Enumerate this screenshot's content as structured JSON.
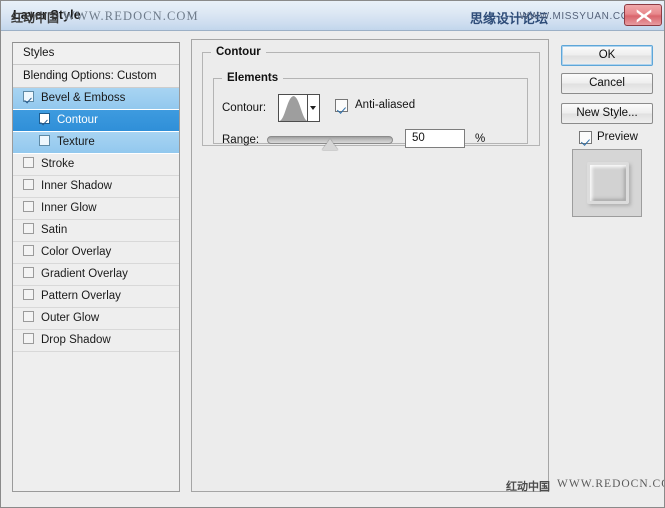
{
  "window": {
    "title": "Layer Style",
    "close_icon": "close-x-icon"
  },
  "watermarks": {
    "title_cn": "红动中国",
    "title_url": "WWW.REDOCN.COM",
    "right_cn": "思缘设计论坛",
    "right_url": "WWW.MISSYUAN.COM",
    "bottom_cn": "红动中国",
    "bottom_url": "WWW.REDOCN.COM"
  },
  "styles_panel": {
    "header": "Styles",
    "blending_options": "Blending Options: Custom",
    "items": [
      {
        "label": "Bevel & Emboss",
        "checked": true,
        "selected": false,
        "sub": false,
        "highlight": "light"
      },
      {
        "label": "Contour",
        "checked": true,
        "selected": true,
        "sub": true,
        "highlight": "strong"
      },
      {
        "label": "Texture",
        "checked": false,
        "selected": false,
        "sub": true,
        "highlight": "light"
      },
      {
        "label": "Stroke",
        "checked": false,
        "selected": false,
        "sub": false,
        "highlight": "none"
      },
      {
        "label": "Inner Shadow",
        "checked": false,
        "selected": false,
        "sub": false,
        "highlight": "none"
      },
      {
        "label": "Inner Glow",
        "checked": false,
        "selected": false,
        "sub": false,
        "highlight": "none"
      },
      {
        "label": "Satin",
        "checked": false,
        "selected": false,
        "sub": false,
        "highlight": "none"
      },
      {
        "label": "Color Overlay",
        "checked": false,
        "selected": false,
        "sub": false,
        "highlight": "none"
      },
      {
        "label": "Gradient Overlay",
        "checked": false,
        "selected": false,
        "sub": false,
        "highlight": "none"
      },
      {
        "label": "Pattern Overlay",
        "checked": false,
        "selected": false,
        "sub": false,
        "highlight": "none"
      },
      {
        "label": "Outer Glow",
        "checked": false,
        "selected": false,
        "sub": false,
        "highlight": "none"
      },
      {
        "label": "Drop Shadow",
        "checked": false,
        "selected": false,
        "sub": false,
        "highlight": "none"
      }
    ]
  },
  "contour_panel": {
    "group_title": "Contour",
    "elements_title": "Elements",
    "contour_label": "Contour:",
    "contour_preset_icon": "contour-curve-swatch",
    "contour_dropdown_icon": "chevron-down-icon",
    "anti_aliased_label": "Anti-aliased",
    "anti_aliased_checked": true,
    "range_label": "Range:",
    "range_value": "50",
    "range_unit": "%",
    "range_percent": 50
  },
  "buttons": {
    "ok": "OK",
    "cancel": "Cancel",
    "new_style": "New Style...",
    "preview_label": "Preview",
    "preview_checked": true
  },
  "colors": {
    "accent_selected": "#2f8fd8",
    "accent_light": "#a8d4f2",
    "dialog_bg": "#ededed",
    "titlebar": "#cfdef0",
    "close_button": "#d9656c"
  }
}
